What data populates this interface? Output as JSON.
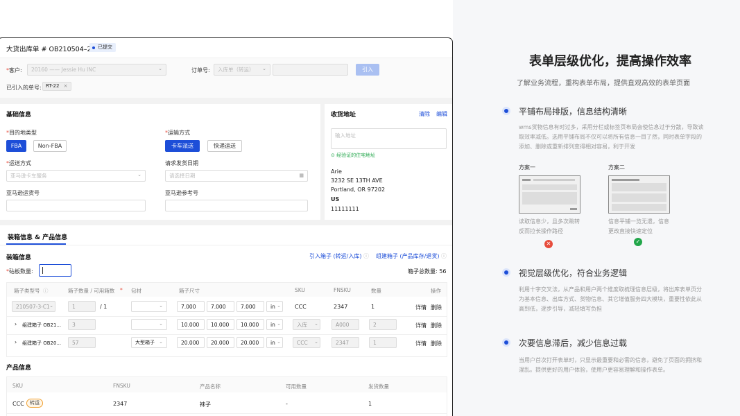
{
  "form": {
    "title": "大货出库单 # OB210504–2",
    "status": "已提交",
    "customer_label": "客户:",
    "customer_value": "20160 —— Jessie Hu INC",
    "order_label": "订单号:",
    "order_type": "入库单（转运）",
    "import_btn": "引入",
    "imported_label": "已引入的单号:",
    "imported_tag": "RT-22",
    "close_icon": "×"
  },
  "basic": {
    "title": "基础信息",
    "dest_type_label": "目的地类型",
    "fba": "FBA",
    "non_fba": "Non-FBA",
    "ship_method_label": "运输方式",
    "truck": "卡车派送",
    "express": "快递运送",
    "ship_mode_label": "运送方式",
    "ship_mode_placeholder": "亚马逊卡车服务",
    "req_date_label": "请求发货日期",
    "req_date_placeholder": "请选择日期",
    "amazon_ship_label": "亚马逊运货号",
    "amazon_ref_label": "亚马逊参考号"
  },
  "address": {
    "title": "收货地址",
    "clear": "清除",
    "edit": "编辑",
    "placeholder": "输入地址",
    "verified": "经验证的住宅地址",
    "name": "Arie",
    "line1": "3232 SE 13TH AVE",
    "line2": "Portland, OR 97202",
    "country": "US",
    "phone": "11111111"
  },
  "packing": {
    "tab": "装箱信息 & 产品信息",
    "title": "装箱信息",
    "import_transfer": "引入箱子 (转运/入库)",
    "combine": "组建箱子 (产品库存/退货)",
    "pallet_label": "砧板数量:",
    "total_label": "箱子总数量:",
    "total_value": "56",
    "headers": [
      "箱子类型号",
      "箱子数量 / 可用箱数",
      "包材",
      "箱子尺寸",
      "SKU",
      "FNSKU",
      "数量",
      "操作"
    ],
    "rows": [
      {
        "type": "210507-3-C1",
        "qty": "1",
        "avail": "/ 1",
        "pack": "",
        "d1": "7.000",
        "d2": "7.000",
        "d3": "7.000",
        "unit": "in",
        "sku": "CCC",
        "fnsku": "2347",
        "num": "1",
        "detail": "详情",
        "del": "删除"
      },
      {
        "type": "组建箱子 OB21...",
        "qty": "3",
        "avail": "",
        "pack": "",
        "d1": "10.000",
        "d2": "10.000",
        "d3": "10.000",
        "unit": "in",
        "sku": "入库",
        "fnsku": "A000",
        "num": "2",
        "detail": "详情",
        "del": "删除"
      },
      {
        "type": "组建箱子 OB20...",
        "qty": "57",
        "avail": "",
        "pack": "大型箱子",
        "d1": "20.000",
        "d2": "20.000",
        "d3": "20.000",
        "unit": "in",
        "sku": "CCC",
        "fnsku": "2347",
        "num": "1",
        "detail": "详情",
        "del": "删除"
      }
    ]
  },
  "product": {
    "title": "产品信息",
    "headers": [
      "SKU",
      "FNSKU",
      "产品名称",
      "可用数量",
      "发货数量"
    ],
    "row": {
      "sku": "CCC",
      "tag": "转运",
      "fnsku": "2347",
      "name": "袜子",
      "avail": "-",
      "ship": "1"
    }
  },
  "right": {
    "title": "表单层级优化，提高操作效率",
    "subtitle": "了解业务流程，重构表单布局，提供直观高效的表单页面",
    "s1_title": "平铺布局排版，信息结构清晰",
    "s1_body": "wms货物信息有时过多，采用分栏或标签页布局会使信息过于分散，导致读取效率减低。选用平铺布局不仅可以将所有信息一目了然，同时表单字段的添加、删除或重新排列变得相对容易，利于开发",
    "plan1": "方案一",
    "plan2": "方案二",
    "plan1_desc": "读取信息少，且多次跳转反而拉长操作路径",
    "plan2_desc": "信息平铺一览无遗，信息更改直接快速定位",
    "s2_title": "视觉层级优化，符合业务逻辑",
    "s2_body": "利用十字交叉法，从产品和用户两个维度取梳理信息层级，将出库表单页分为基本信息、出库方式、货物信息、其它增值服务四大模块，重要性依此从高到低，逐步引导，减轻填写负担",
    "s3_title": "次要信息滞后，减少信息过载",
    "s3_body": "当用户首次打开表单时，只显示最重要和必需的信息，避免了页面的拥挤和混乱。提供更好的用户体验，使用户更容易理解和操作表单。"
  }
}
